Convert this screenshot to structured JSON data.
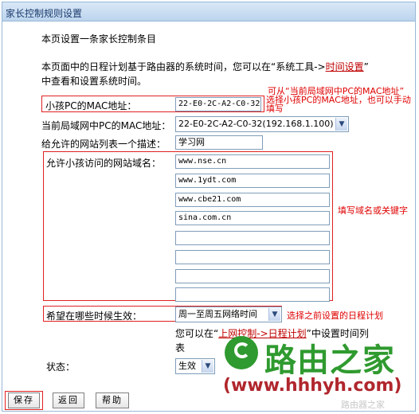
{
  "window": {
    "title": "家长控制规则设置"
  },
  "intro": {
    "heading": "本页设置一条家长控制条目",
    "line1_a": "本页面中的日程计划基于路由器的系统时间，您可以在“系统工具->",
    "line1_link": "时间设置",
    "line1_b": "”",
    "line2": "中查看和设置系统时间。"
  },
  "form": {
    "child_mac_label": "小孩PC的MAC地址：",
    "child_mac_value": "22-E0-2C-A2-C0-32",
    "lan_mac_label": "当前局域网中PC的MAC地址：",
    "lan_mac_selected": "22-E0-2C-A2-C0-32(192.168.1.100)",
    "desc_label": "给允许的网站列表一个描述：",
    "desc_value": "学习网",
    "domains_label": "允许小孩访问的网站域名：",
    "domains": [
      "www.nse.cn",
      "www.1ydt.com",
      "www.cbe21.com",
      "sina.com.cn",
      "",
      "",
      "",
      ""
    ],
    "schedule_label": "希望在哪些时候生效：",
    "schedule_selected": "周一至周五网络时间",
    "schedule_hint_a": "您可以在“",
    "schedule_hint_link1": "上网控制->",
    "schedule_hint_link2": "日程计划",
    "schedule_hint_b": "”中设置时间列",
    "schedule_hint_c": "表",
    "status_label": "状态：",
    "status_selected": "生效"
  },
  "annotations": {
    "mac_line1": "可从“当前局域网中PC的MAC地址”",
    "mac_line2": "选择小孩PC的MAC地址，也可以手动",
    "mac_line3": "填写",
    "domain_note": "填写域名或关键字",
    "schedule_note": "选择之前设置的日程计划"
  },
  "buttons": {
    "save": "保存",
    "back": "返回",
    "help": "帮助"
  },
  "watermark": {
    "brand": "路由之家",
    "url": "(www.hhhyh.com)",
    "faint": "路由器之家"
  },
  "colors": {
    "annotation_red": "#e00000",
    "link_red": "#c00000",
    "title_blue": "#1a3a6b",
    "logo_green": "#2f9a2f"
  }
}
